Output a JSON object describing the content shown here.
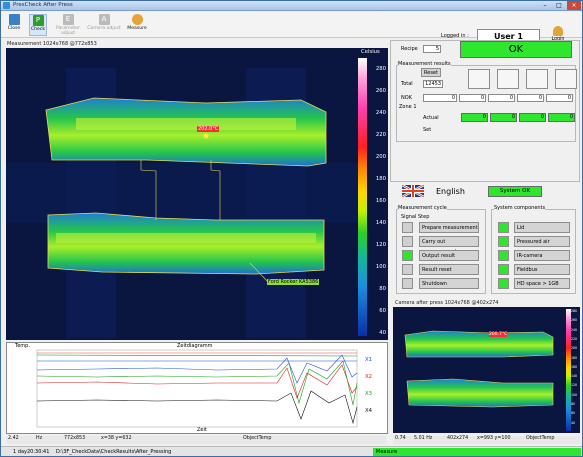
{
  "window": {
    "title": "PresCheck After Press"
  },
  "toolbar": {
    "buttons": [
      {
        "label": "Close",
        "icon": "close-icon",
        "state": "normal"
      },
      {
        "label": "Check",
        "icon": "check-icon",
        "state": "active"
      },
      {
        "label": "Parameter adjust",
        "icon": "parameter-icon",
        "state": "disabled"
      },
      {
        "label": "Camera adjust",
        "icon": "camera-icon",
        "state": "disabled"
      },
      {
        "label": "Measure",
        "icon": "measure-icon",
        "state": "normal"
      }
    ],
    "logged_in_label": "Logged in :",
    "user": "User 1",
    "login_label": "Login"
  },
  "main_view": {
    "title": "Measurement 1024x768 @772x853",
    "colorbar_unit": "Celsius",
    "colorbar_ticks": [
      "280",
      "260",
      "240",
      "220",
      "200",
      "180",
      "160",
      "140",
      "120",
      "100",
      "80",
      "60",
      "40"
    ],
    "hotspot_label": "202.0°C",
    "part_label": "Ford Rocker KA5386",
    "status": {
      "a": "2.42",
      "b": "Hz",
      "c": "772x853",
      "d": "x=38 y=632",
      "e": "ObjectTemp"
    }
  },
  "trend": {
    "title": "Zeitdiagramm",
    "ylabel": "Temp.",
    "xlabel": "Zeit",
    "legend": [
      "X1",
      "X2",
      "X3",
      "X4"
    ],
    "colors": [
      "#1f4fd8",
      "#d81f1f",
      "#1a9a1a",
      "#111111"
    ]
  },
  "right_panel": {
    "recipe_label": "Recipe",
    "recipe_value": "5",
    "result": "OK",
    "results_group": "Measurement results",
    "reset_label": "Reset",
    "total_label": "Total",
    "total_value": "12453",
    "nok_label": "NOK",
    "nok_values": [
      "0",
      "0",
      "0",
      "0",
      "0"
    ],
    "zone_label": "Zone 1",
    "actual_label": "Actual",
    "actual_values": [
      "0",
      "0",
      "0",
      "0"
    ],
    "set_label": "Set",
    "language": "English",
    "system_status": "System OK",
    "cycle_group": "Measurement cycle",
    "signal_label": "Signal",
    "step_label": "Step",
    "steps": [
      {
        "label": "Prepare measurement",
        "active": false
      },
      {
        "label": "Carry out measurement",
        "active": false
      },
      {
        "label": "Output result",
        "active": true
      },
      {
        "label": "Result reset",
        "active": false
      },
      {
        "label": "Shutdown",
        "active": false
      }
    ],
    "components_group": "System components",
    "components": [
      "Lid",
      "Pressured air",
      "IR-camera",
      "Fieldbus",
      "HD space > 1GB"
    ]
  },
  "small_view": {
    "title": "Camera after press 1024x768 @402x274",
    "hotspot_label": "200.7°C",
    "colorbar_ticks": [
      "280",
      "260",
      "240",
      "220",
      "200",
      "180",
      "160",
      "140",
      "120",
      "100",
      "80",
      "60",
      "40"
    ],
    "status": {
      "a": "0.74",
      "b": "5.01 Hz",
      "c": "402x274",
      "d": "x=993 y=100",
      "e": "ObjectTemp"
    }
  },
  "statusbar": {
    "time": "1 day20:30:41",
    "path": "D:\\3F_CheckData\\CheckResults\\After_Pressing",
    "message": "Measure"
  }
}
